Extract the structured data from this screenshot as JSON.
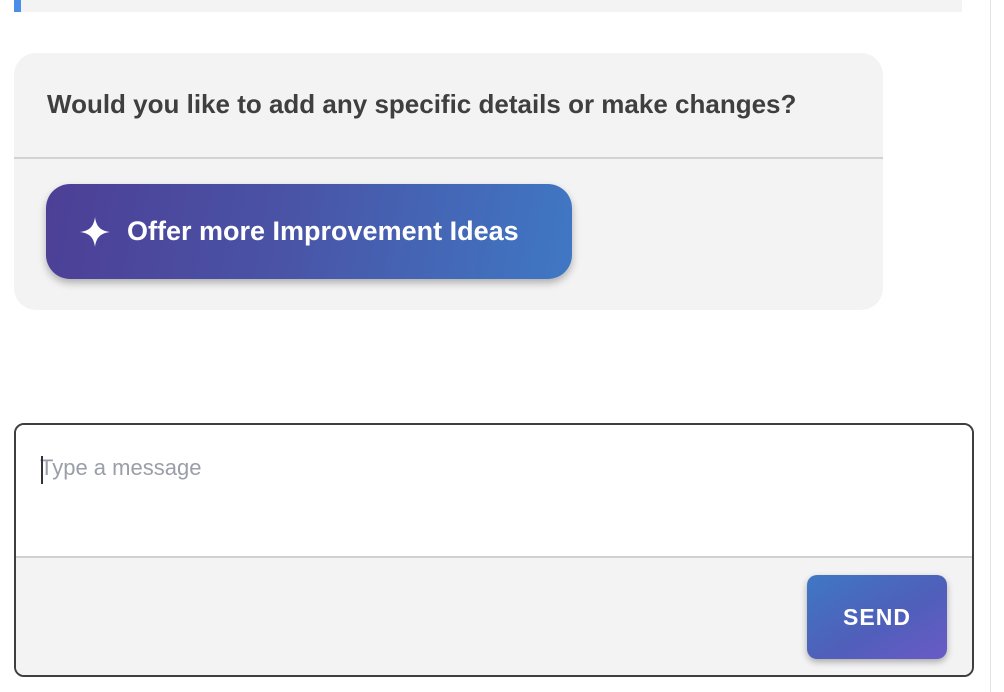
{
  "chat": {
    "assistant_message": "Would you like to add any specific details or make changes?",
    "suggestion": {
      "icon": "sparkle-icon",
      "label": "Offer more Improvement Ideas"
    }
  },
  "composer": {
    "placeholder": "Type a message",
    "value": "",
    "send_label": "SEND"
  },
  "colors": {
    "previous_card_accent": "#4a8ee8",
    "bubble_background": "#f3f3f3",
    "button_gradient_start": "#4c3f96",
    "button_gradient_end": "#3f78c4",
    "send_gradient_end": "#6a5ac6",
    "text_dark": "#3f3f3f",
    "placeholder": "#9a9ea8"
  }
}
